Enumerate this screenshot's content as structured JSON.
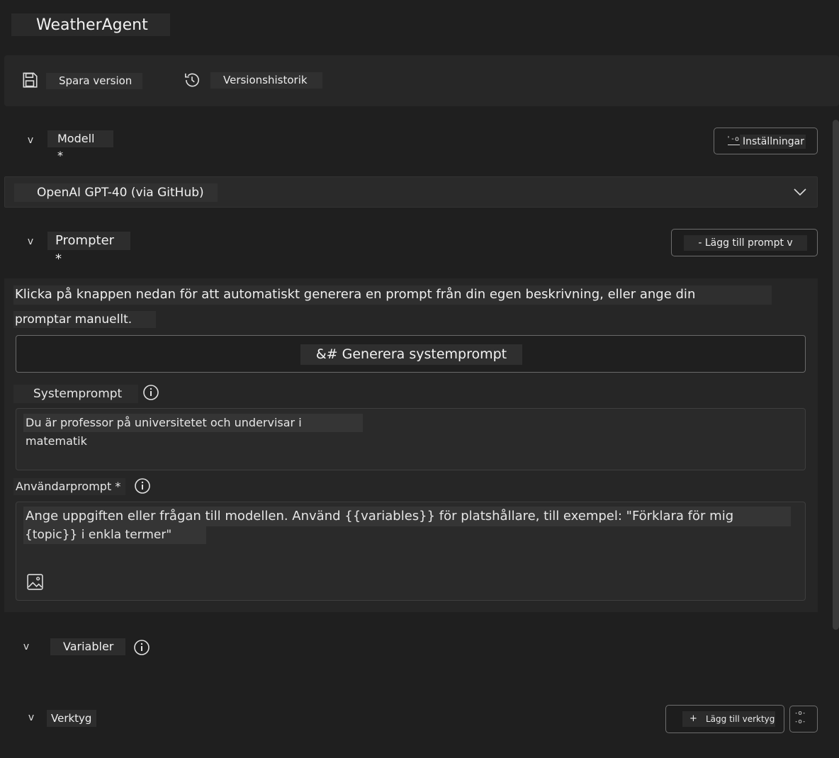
{
  "app": {
    "title": "WeatherAgent"
  },
  "toolbar": {
    "save_label": "Spara version",
    "history_label": "Versionshistorik"
  },
  "model_section": {
    "chevron": "v",
    "label": "Modell *",
    "settings_glyph": "'-o",
    "settings_label": "Inställningar",
    "selected_model": "OpenAI GPT-40 (via GitHub)"
  },
  "prompt_section": {
    "chevron": "v",
    "label": "Prompter *",
    "add_prompt_label": "- Lägg till prompt v",
    "intro_line1": "Klicka på knappen nedan för att automatiskt generera en prompt från din egen beskrivning, eller ange din",
    "intro_line2": "promptar manuellt.",
    "generate_label": "&# Generera systemprompt",
    "system_prompt_label": "Systemprompt",
    "system_prompt_value": "Du är professor på universitetet och undervisar i matematik",
    "user_prompt_label": "Användarprompt *",
    "user_prompt_line1": "Ange uppgiften eller frågan till modellen. Använd {{variables}} för platshållare, till exempel: \"Förklara för mig",
    "user_prompt_line2": "{topic}} i enkla termer\""
  },
  "variables_section": {
    "chevron": "v",
    "label": "Variabler"
  },
  "tools_section": {
    "chevron": "v",
    "label": "Verktyg",
    "add_tool_plus": "+",
    "add_tool_label": "Lägg till verktyg",
    "extra_glyph_1": "-o-",
    "extra_glyph_2": "-o-"
  },
  "icons": {
    "save": "save-icon",
    "history": "history-icon",
    "chevron_down": "chevron-down-icon",
    "info": "info-icon",
    "image": "image-icon",
    "settings_slider": "sliders-icon"
  }
}
